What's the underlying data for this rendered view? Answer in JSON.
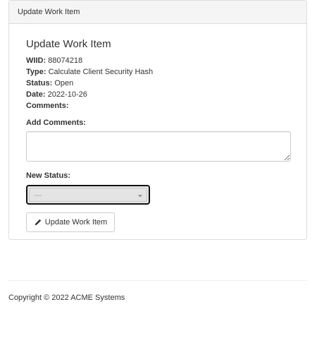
{
  "panel": {
    "heading": "Update Work Item"
  },
  "form": {
    "title": "Update Work Item",
    "fields": [
      {
        "label": "WIID:",
        "value": "88074218"
      },
      {
        "label": "Type:",
        "value": "Calculate Client Security Hash"
      },
      {
        "label": "Status:",
        "value": "Open"
      },
      {
        "label": "Date:",
        "value": "2022-10-26"
      },
      {
        "label": "Comments:",
        "value": ""
      }
    ],
    "add_comments_label": "Add Comments:",
    "comments_value": "",
    "new_status_label": "New Status:",
    "new_status_selected": "---",
    "submit_label": "Update Work Item",
    "submit_icon": "pencil-icon"
  },
  "footer": {
    "copyright": "Copyright © 2022 ACME Systems"
  }
}
